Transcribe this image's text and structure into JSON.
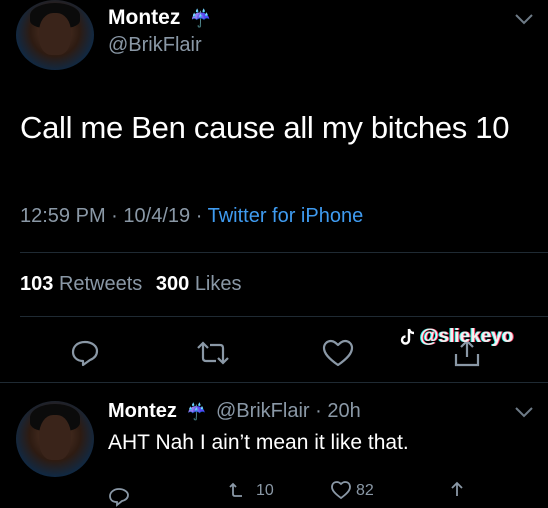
{
  "tweet": {
    "author_name": "Montez",
    "author_handle": "@BrikFlair",
    "name_emoji": "☔",
    "text": "Call me Ben cause all my bitches 10",
    "time": "12:59 PM",
    "date": "10/4/19",
    "source": "Twitter for iPhone",
    "separator": "·",
    "retweets_count": "103",
    "retweets_label": "Retweets",
    "likes_count": "300",
    "likes_label": "Likes"
  },
  "watermark": "@sliekeyo",
  "reply": {
    "author_name": "Montez",
    "name_emoji": "☔",
    "handle_time": "@BrikFlair · 20h",
    "text": "AHT Nah I ain’t mean it like that.",
    "retweets_partial": "10",
    "likes_partial": "82"
  },
  "colors": {
    "background": "#000000",
    "link_blue": "#3f9bf0",
    "muted_gray": "#8a98a6",
    "divider": "#1f2a33"
  },
  "icons": {
    "menu": "chevron-down-icon",
    "reply": "reply-icon",
    "retweet": "retweet-icon",
    "like": "heart-icon",
    "share": "share-icon"
  }
}
